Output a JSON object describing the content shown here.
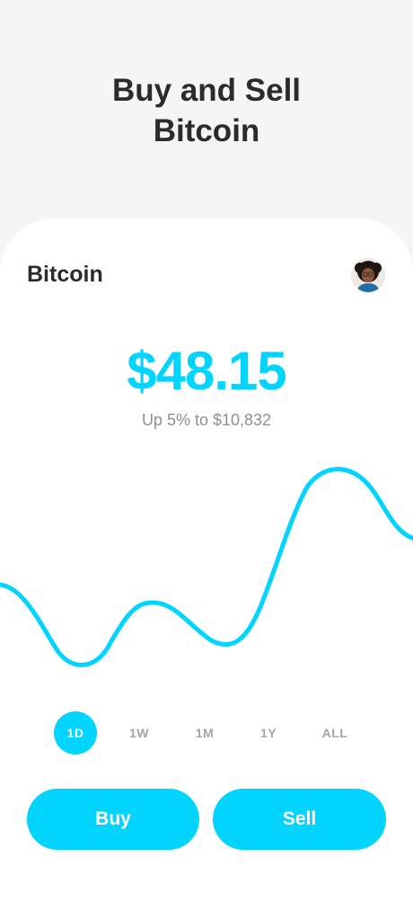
{
  "promo": {
    "title_line1": "Buy and Sell",
    "title_line2": "Bitcoin"
  },
  "screen": {
    "title": "Bitcoin",
    "balance": "$48.15",
    "change": "Up 5% to $10,832"
  },
  "ranges": [
    {
      "label": "1D",
      "active": true
    },
    {
      "label": "1W",
      "active": false
    },
    {
      "label": "1M",
      "active": false
    },
    {
      "label": "1Y",
      "active": false
    },
    {
      "label": "ALL",
      "active": false
    }
  ],
  "actions": {
    "buy_label": "Buy",
    "sell_label": "Sell"
  },
  "colors": {
    "accent": "#00d4ff",
    "background": "#f5f5f5",
    "card": "#ffffff",
    "title_text": "#2b2b2b",
    "muted_text": "#8f8f8f"
  },
  "icons": {
    "avatar": "user-avatar"
  }
}
